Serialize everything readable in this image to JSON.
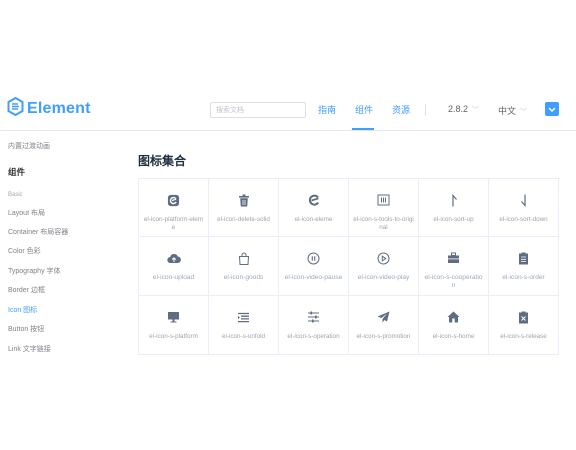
{
  "header": {
    "logo_text": "Element",
    "search_placeholder": "搜索文档",
    "nav": [
      "指南",
      "组件",
      "资源"
    ],
    "version": "2.8.2",
    "language": "中文",
    "brand_color": "#409eff"
  },
  "sidebar": {
    "top_item": "内置过渡动画",
    "heading": "组件",
    "group": "Basic",
    "items": [
      "Layout 布局",
      "Container 布局容器",
      "Color 色彩",
      "Typography 字体",
      "Border 边框",
      "Icon 图标",
      "Button 按钮",
      "Link 文字链接"
    ]
  },
  "main": {
    "title": "图标集合",
    "icons": [
      {
        "name": "el-icon-platform-eleme",
        "icon": "eleme-icon"
      },
      {
        "name": "el-icon-delete-solid",
        "icon": "delete-solid-icon"
      },
      {
        "name": "el-icon-eleme",
        "icon": "eleme-icon"
      },
      {
        "name": "el-icon-s-tools-to-original",
        "icon": "original-icon"
      },
      {
        "name": "el-icon-sort-up",
        "icon": "sort-up-icon"
      },
      {
        "name": "el-icon-sort-down",
        "icon": "sort-down-icon"
      },
      {
        "name": "el-icon-upload",
        "icon": "upload-icon"
      },
      {
        "name": "el-icon-goods",
        "icon": "goods-icon"
      },
      {
        "name": "el-icon-video-pause",
        "icon": "video-pause-icon"
      },
      {
        "name": "el-icon-video-play",
        "icon": "video-play-icon"
      },
      {
        "name": "el-icon-s-cooperation",
        "icon": "cooperation-icon"
      },
      {
        "name": "el-icon-s-order",
        "icon": "order-icon"
      },
      {
        "name": "el-icon-s-platform",
        "icon": "platform-icon"
      },
      {
        "name": "el-icon-s-unfold",
        "icon": "unfold-icon"
      },
      {
        "name": "el-icon-s-operation",
        "icon": "operation-icon"
      },
      {
        "name": "el-icon-s-promotion",
        "icon": "promotion-icon"
      },
      {
        "name": "el-icon-s-home",
        "icon": "home-icon"
      },
      {
        "name": "el-icon-s-release",
        "icon": "release-icon"
      }
    ]
  }
}
